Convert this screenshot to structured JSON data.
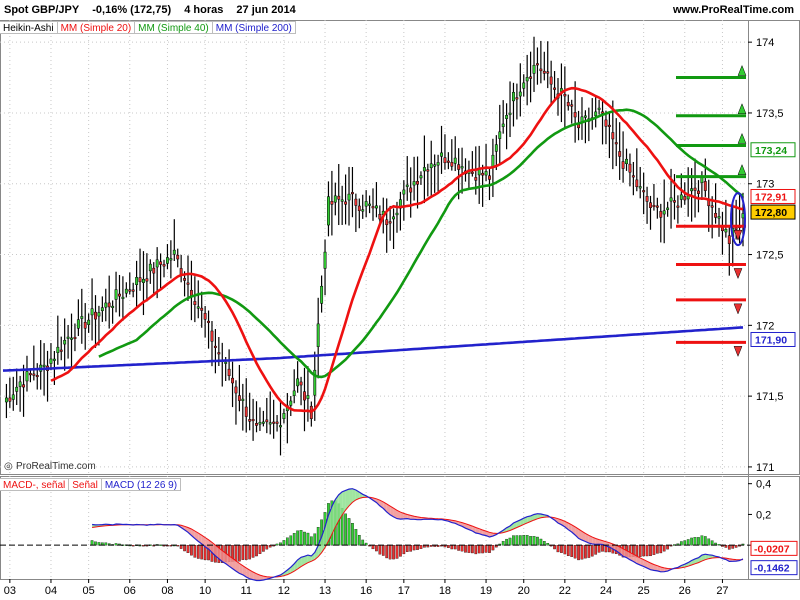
{
  "header": {
    "instrument": "Spot GBP/JPY",
    "change": "-0,16% (172,75)",
    "timeframe": "4 horas",
    "date": "27 jun 2014",
    "site": "www.ProRealTime.com"
  },
  "legend": {
    "ha": "Heikin-Ashi",
    "ma20": "MM (Simple 20)",
    "ma40": "MM (Simple 40)",
    "ma200": "MM (Simple 200)"
  },
  "macd_legend": {
    "a": "MACD-, señal",
    "b": "Señal",
    "c": "MACD (12 26 9)"
  },
  "watermark": "ProRealTime.com",
  "colors": {
    "up": "#33cc33",
    "down": "#e53030",
    "ma20": "#ee1111",
    "ma40": "#119911",
    "ma200": "#2222cc",
    "grid": "#c8c8c8"
  },
  "price_axis": {
    "ticks": [
      {
        "v": 171,
        "label": "171"
      },
      {
        "v": 171.5,
        "label": "171,5"
      },
      {
        "v": 172,
        "label": "172"
      },
      {
        "v": 172.5,
        "label": "172,5"
      },
      {
        "v": 173,
        "label": "173"
      },
      {
        "v": 173.5,
        "label": "173,5"
      },
      {
        "v": 174,
        "label": "174"
      }
    ],
    "badges": [
      {
        "v": 173.24,
        "label": "173,24",
        "color": "#119911"
      },
      {
        "v": 172.91,
        "label": "172,91",
        "color": "#ee1111"
      },
      {
        "v": 172.8,
        "label": "172,80",
        "color": "#000000",
        "fill": "#ffcc00"
      },
      {
        "v": 171.9,
        "label": "171,90",
        "color": "#2222cc"
      }
    ]
  },
  "macd_axis": {
    "ticks": [
      {
        "v": 0.4,
        "label": "0,4"
      },
      {
        "v": 0.2,
        "label": "0,2"
      },
      {
        "v": 0,
        "label": "0"
      }
    ],
    "badges": [
      {
        "v": -0.0207,
        "label": "-0,0207",
        "color": "#ee1111"
      },
      {
        "v": -0.1462,
        "label": "-0,1462",
        "color": "#2222cc"
      }
    ]
  },
  "x_axis": {
    "labels": [
      {
        "i": 2,
        "label": "03"
      },
      {
        "i": 14,
        "label": "04"
      },
      {
        "i": 25,
        "label": "05"
      },
      {
        "i": 37,
        "label": "06"
      },
      {
        "i": 48,
        "label": "08"
      },
      {
        "i": 59,
        "label": "10"
      },
      {
        "i": 71,
        "label": "11"
      },
      {
        "i": 82,
        "label": "12"
      },
      {
        "i": 94,
        "label": "13"
      },
      {
        "i": 106,
        "label": "16"
      },
      {
        "i": 117,
        "label": "17"
      },
      {
        "i": 129,
        "label": "18"
      },
      {
        "i": 141,
        "label": "19"
      },
      {
        "i": 152,
        "label": "20"
      },
      {
        "i": 164,
        "label": "22"
      },
      {
        "i": 176,
        "label": "24"
      },
      {
        "i": 187,
        "label": "25"
      },
      {
        "i": 199,
        "label": "26"
      },
      {
        "i": 210,
        "label": "27"
      }
    ]
  },
  "chart_data": {
    "type": "candlestick",
    "y_range": [
      170.95,
      174.1
    ],
    "macd_range": [
      -0.22,
      0.45
    ],
    "levels": {
      "green": [
        173.75,
        173.48,
        173.27,
        173.05
      ],
      "red": [
        172.7,
        172.43,
        172.18,
        171.88
      ]
    },
    "keypoints": [
      {
        "i": 0,
        "p": 171.45
      },
      {
        "i": 5,
        "p": 171.6
      },
      {
        "i": 12,
        "p": 171.7
      },
      {
        "i": 20,
        "p": 171.95
      },
      {
        "i": 28,
        "p": 172.1
      },
      {
        "i": 36,
        "p": 172.25
      },
      {
        "i": 44,
        "p": 172.4
      },
      {
        "i": 50,
        "p": 172.5
      },
      {
        "i": 56,
        "p": 172.2
      },
      {
        "i": 62,
        "p": 171.85
      },
      {
        "i": 68,
        "p": 171.55
      },
      {
        "i": 74,
        "p": 171.25
      },
      {
        "i": 80,
        "p": 171.3
      },
      {
        "i": 86,
        "p": 171.6
      },
      {
        "i": 90,
        "p": 171.4
      },
      {
        "i": 92,
        "p": 172.0
      },
      {
        "i": 95,
        "p": 172.85
      },
      {
        "i": 100,
        "p": 172.9
      },
      {
        "i": 106,
        "p": 172.85
      },
      {
        "i": 112,
        "p": 172.75
      },
      {
        "i": 118,
        "p": 172.95
      },
      {
        "i": 124,
        "p": 173.15
      },
      {
        "i": 130,
        "p": 173.2
      },
      {
        "i": 136,
        "p": 173.1
      },
      {
        "i": 142,
        "p": 173.05
      },
      {
        "i": 146,
        "p": 173.45
      },
      {
        "i": 152,
        "p": 173.75
      },
      {
        "i": 156,
        "p": 173.85
      },
      {
        "i": 160,
        "p": 173.7
      },
      {
        "i": 164,
        "p": 173.6
      },
      {
        "i": 168,
        "p": 173.4
      },
      {
        "i": 174,
        "p": 173.5
      },
      {
        "i": 180,
        "p": 173.2
      },
      {
        "i": 186,
        "p": 172.95
      },
      {
        "i": 190,
        "p": 172.8
      },
      {
        "i": 196,
        "p": 172.85
      },
      {
        "i": 200,
        "p": 172.95
      },
      {
        "i": 204,
        "p": 173.0
      },
      {
        "i": 208,
        "p": 172.8
      },
      {
        "i": 212,
        "p": 172.6
      },
      {
        "i": 216,
        "p": 172.75
      }
    ],
    "bar_count": 217
  }
}
